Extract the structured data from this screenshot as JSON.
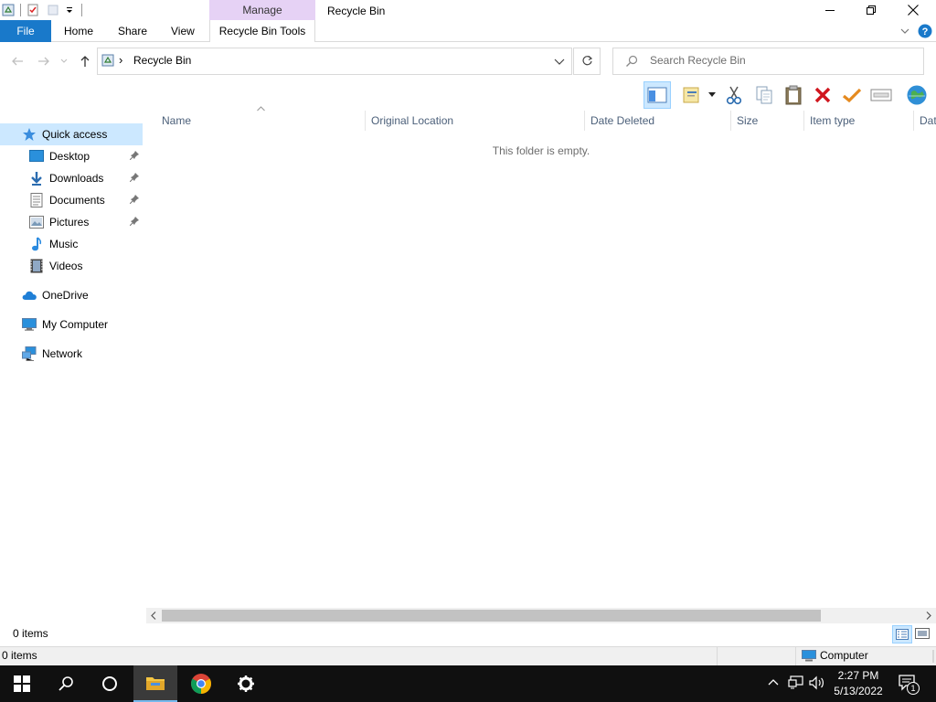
{
  "window": {
    "title": "Recycle Bin",
    "contextual_tab_group": "Manage"
  },
  "ribbon": {
    "tabs": [
      {
        "label": "File"
      },
      {
        "label": "Home"
      },
      {
        "label": "Share"
      },
      {
        "label": "View"
      },
      {
        "label": "Recycle Bin Tools"
      }
    ],
    "help_icon": "help-icon"
  },
  "address": {
    "separator": "›",
    "path": "Recycle Bin",
    "search_placeholder": "Search Recycle Bin"
  },
  "navigation": {
    "quick_access_label": "Quick access",
    "quick_access_items": [
      {
        "label": "Desktop",
        "pinned": true
      },
      {
        "label": "Downloads",
        "pinned": true
      },
      {
        "label": "Documents",
        "pinned": true
      },
      {
        "label": "Pictures",
        "pinned": true
      },
      {
        "label": "Music",
        "pinned": false
      },
      {
        "label": "Videos",
        "pinned": false
      }
    ],
    "roots": [
      {
        "label": "OneDrive"
      },
      {
        "label": "My Computer"
      },
      {
        "label": "Network"
      }
    ]
  },
  "content": {
    "columns": [
      "Name",
      "Original Location",
      "Date Deleted",
      "Size",
      "Item type",
      "Dat"
    ],
    "sorted_column": "Name",
    "empty_message": "This folder is empty."
  },
  "status": {
    "item_count": "0 items",
    "bottom_item_count": "0 items",
    "zone": "Computer"
  },
  "taskbar": {
    "time": "2:27 PM",
    "date": "5/13/2022",
    "notification_count": "1"
  },
  "colors": {
    "file_tab": "#1979ca",
    "manage_tab": "#e6d2f5",
    "selection": "#cce8ff",
    "taskbar": "#101010"
  }
}
